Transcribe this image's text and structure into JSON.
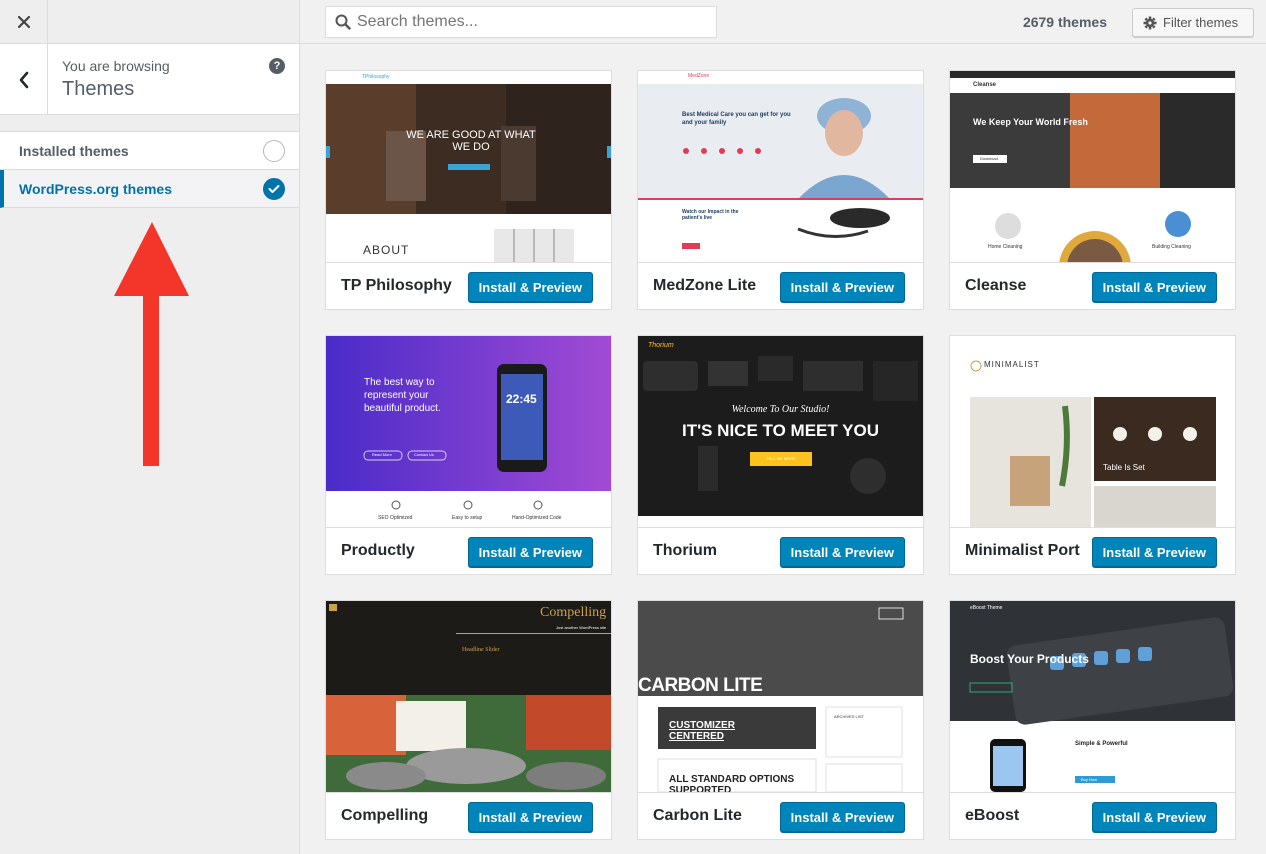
{
  "sidebar": {
    "close_icon": "close-icon",
    "back_icon": "chevron-left-icon",
    "browsing_label": "You are browsing",
    "browsing_title": "Themes",
    "help_icon": "?",
    "sections": [
      {
        "label": "Installed themes",
        "checked": false
      },
      {
        "label": "WordPress.org themes",
        "checked": true
      }
    ]
  },
  "annotation": {
    "arrow_color": "#f4362a"
  },
  "header": {
    "search_placeholder": "Search themes...",
    "count": "2679 themes",
    "filter_label": "Filter themes"
  },
  "colors": {
    "accent": "#0073aa",
    "button": "#0085ba"
  },
  "themes": [
    {
      "name": "TP Philosophy",
      "button": "Install & Preview",
      "shot": {
        "header_logo": "TPhilosophy",
        "hero": "WE ARE GOOD AT WHAT WE DO",
        "section": "ABOUT"
      }
    },
    {
      "name": "MedZone Lite",
      "button": "Install & Preview",
      "shot": {
        "logo": "MedZone",
        "hero": "Best Medical Care you can get for you and your family",
        "impact": "Watch our Impact in the patient's live"
      }
    },
    {
      "name": "Cleanse",
      "button": "Install & Preview",
      "shot": {
        "logo": "Cleanse",
        "hero": "We Keep Your World Fresh",
        "cta": "Download",
        "service_1": "Home Cleaning",
        "service_2": "Building Cleaning"
      }
    },
    {
      "name": "Productly",
      "button": "Install & Preview",
      "shot": {
        "hero": "The best way to represent your beautiful product.",
        "time": "22:45",
        "feature_1": "SEO Optimized",
        "feature_2": "Easy to setup",
        "feature_3": "Hand-Optimized Code",
        "btn_1": "Read More",
        "btn_2": "Contact Us"
      }
    },
    {
      "name": "Thorium",
      "button": "Install & Preview",
      "shot": {
        "logo": "Thorium",
        "subtitle": "Welcome To Our Studio!",
        "hero": "IT'S NICE TO MEET YOU",
        "cta": "TELL ME MORE"
      }
    },
    {
      "name": "Minimalist Port",
      "button": "Install & Preview",
      "shot": {
        "logo": "MINIMALIST",
        "caption": "Table Is Set"
      }
    },
    {
      "name": "Compelling",
      "button": "Install & Preview",
      "shot": {
        "logo": "Compelling",
        "tagline": "Just another WordPress site",
        "post": "Headline Slider"
      }
    },
    {
      "name": "Carbon Lite",
      "button": "Install & Preview",
      "shot": {
        "title": "CARBON LITE",
        "post_1": "CUSTOMIZER CENTERED",
        "post_2": "ALL STANDARD OPTIONS SUPPORTED",
        "sidebar": "ARCHIVES LIST"
      }
    },
    {
      "name": "eBoost",
      "button": "Install & Preview",
      "shot": {
        "logo": "eBoost Theme",
        "hero": "Boost Your Products",
        "feature": "Simple & Powerful",
        "cta": "Buy Now"
      }
    }
  ]
}
